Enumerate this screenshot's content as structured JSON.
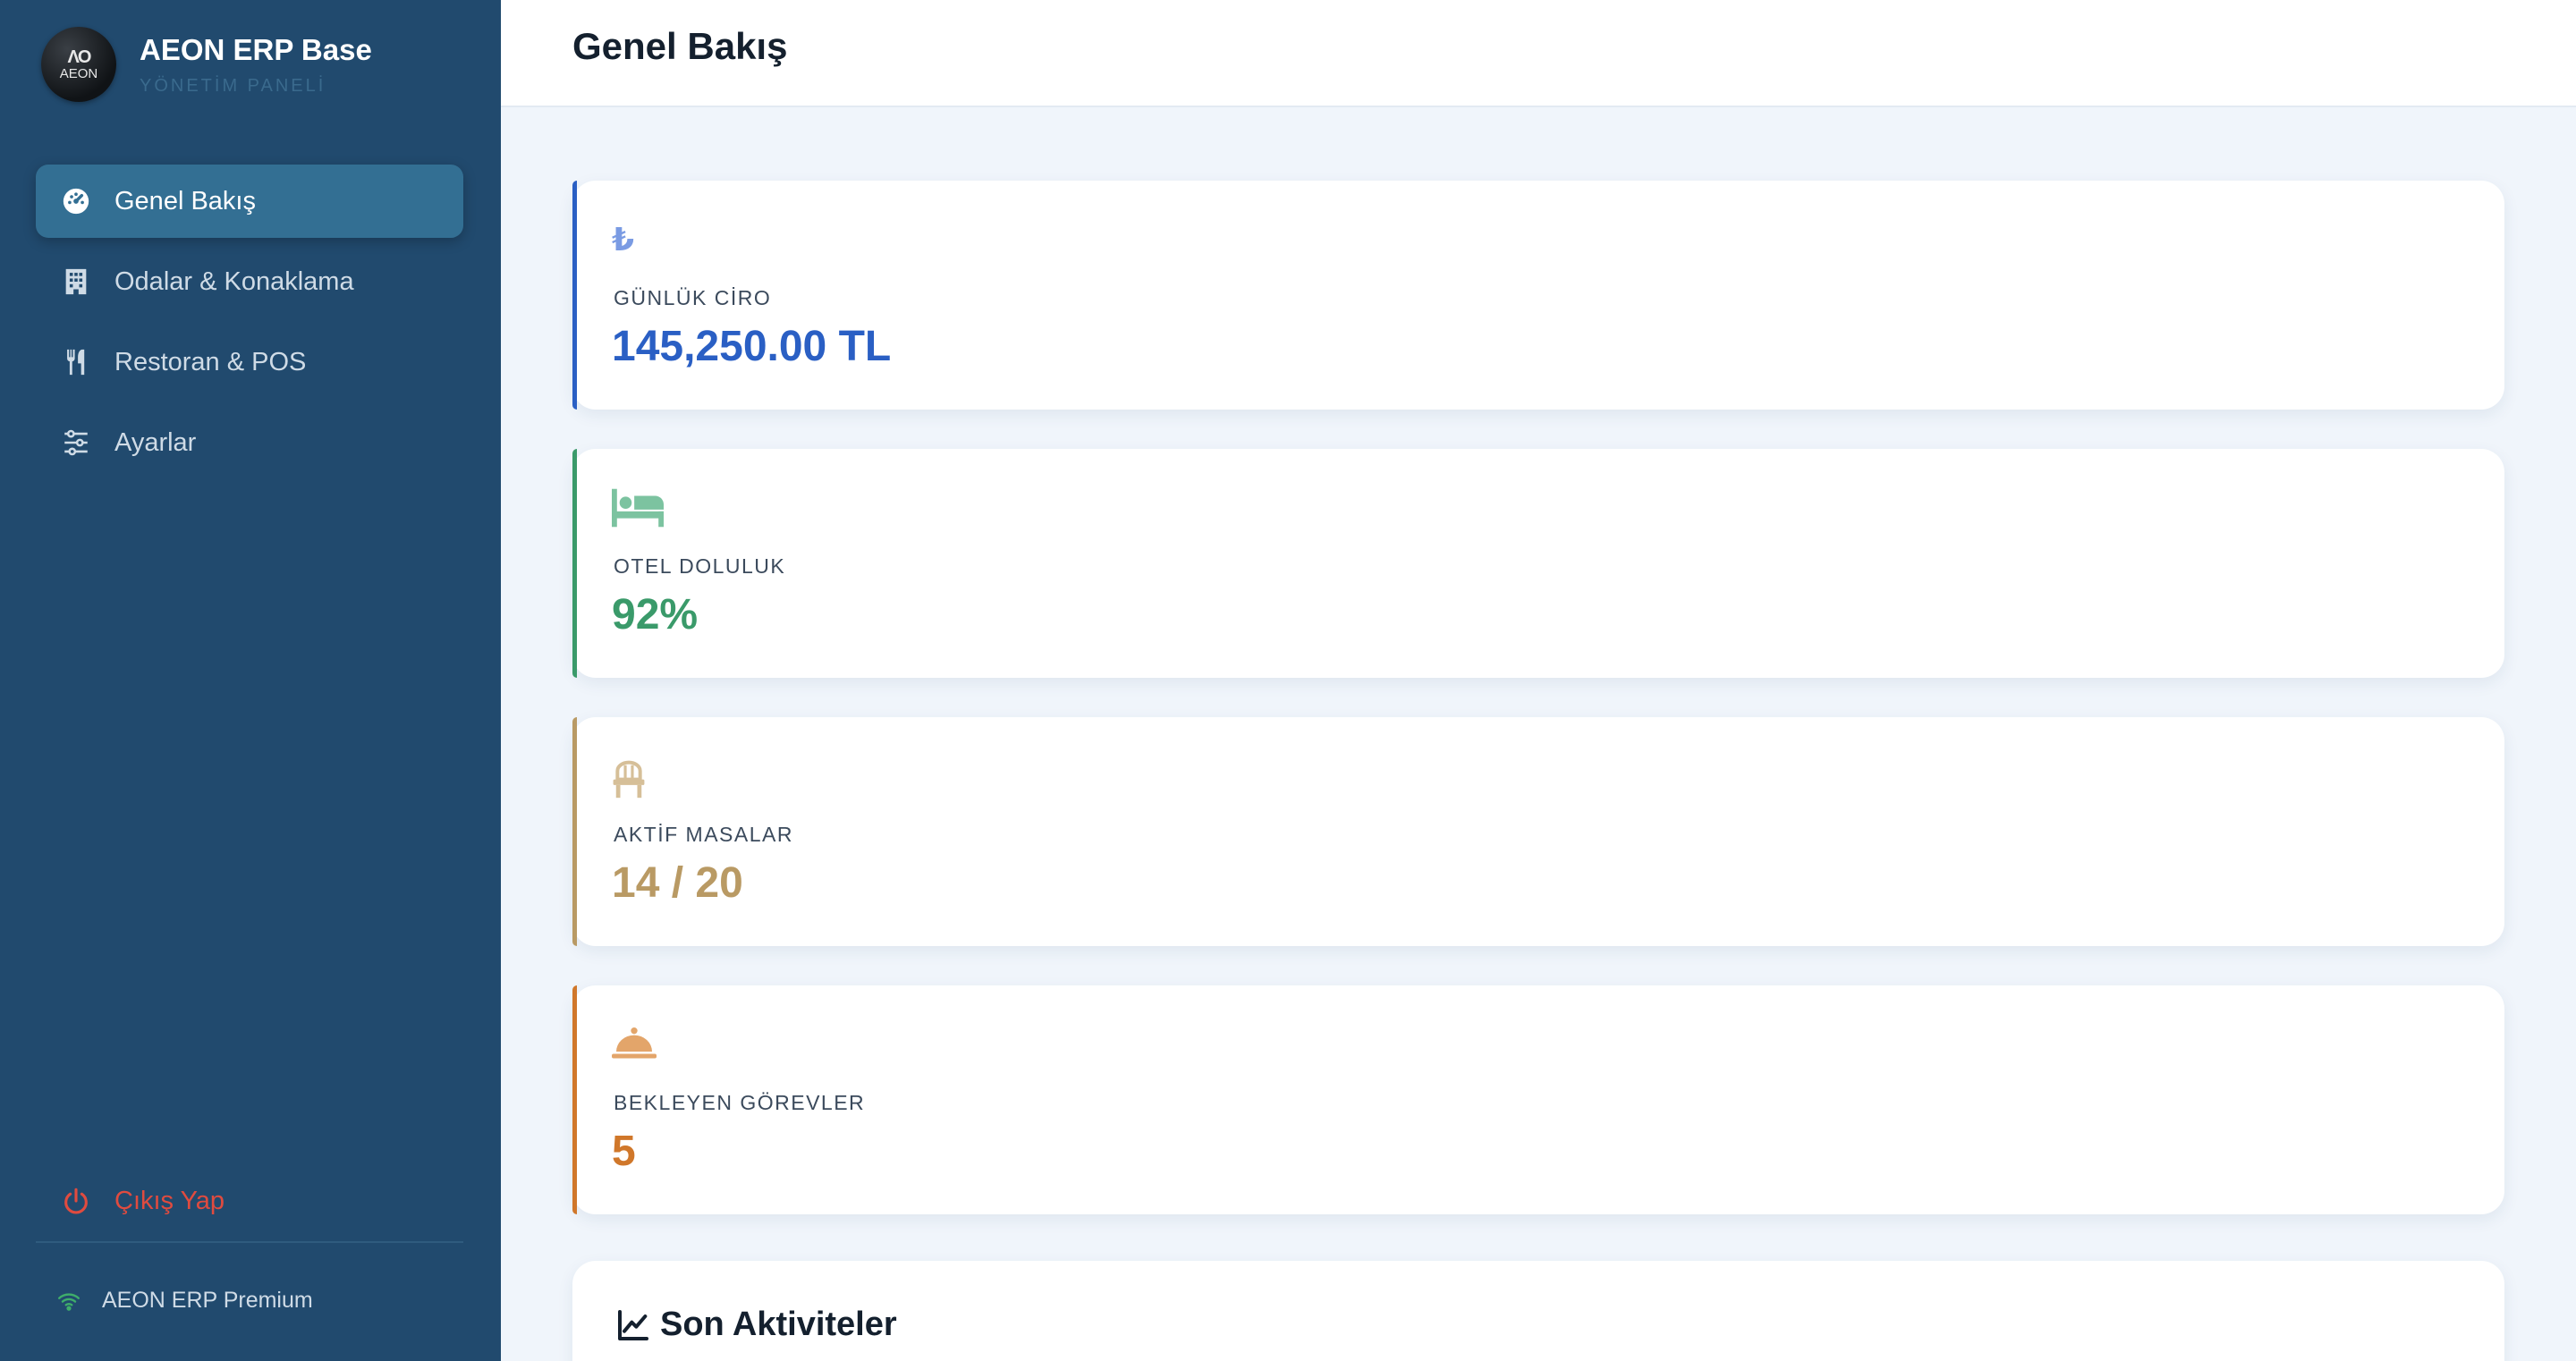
{
  "brand": {
    "logo_text": "AEON",
    "logo_mark": "ΛO",
    "title": "AEON ERP Base",
    "subtitle": "YÖNETİM PANELİ"
  },
  "sidebar": {
    "items": [
      {
        "label": "Genel Bakış",
        "icon": "dashboard-icon",
        "active": true
      },
      {
        "label": "Odalar & Konaklama",
        "icon": "building-icon",
        "active": false
      },
      {
        "label": "Restoran & POS",
        "icon": "utensils-icon",
        "active": false
      },
      {
        "label": "Ayarlar",
        "icon": "sliders-icon",
        "active": false
      }
    ],
    "logout_label": "Çıkış Yap",
    "status_label": "AEON ERP Premium"
  },
  "header": {
    "title": "Genel Bakış"
  },
  "cards": [
    {
      "label": "GÜNLÜK CİRO",
      "value": "145,250.00 TL",
      "icon": "lira-icon",
      "color": "#2a5fc4",
      "icon_color": "#7a9be3"
    },
    {
      "label": "OTEL DOLULUK",
      "value": "92%",
      "icon": "bed-icon",
      "color": "#3a9a6a",
      "icon_color": "#7cc3a0"
    },
    {
      "label": "AKTİF MASALAR",
      "value": "14 / 20",
      "icon": "chair-icon",
      "color": "#b99a64",
      "icon_color": "#d6bf98"
    },
    {
      "label": "BEKLEYEN GÖREVLER",
      "value": "5",
      "icon": "service-bell-icon",
      "color": "#d0772a",
      "icon_color": "#e3a56a"
    }
  ],
  "activity": {
    "title": "Son Aktiviteler"
  },
  "colors": {
    "sidebar_bg": "#214a6e",
    "sidebar_active": "#336f93",
    "logout": "#e04b3f",
    "status_dot": "#3fae6a"
  }
}
